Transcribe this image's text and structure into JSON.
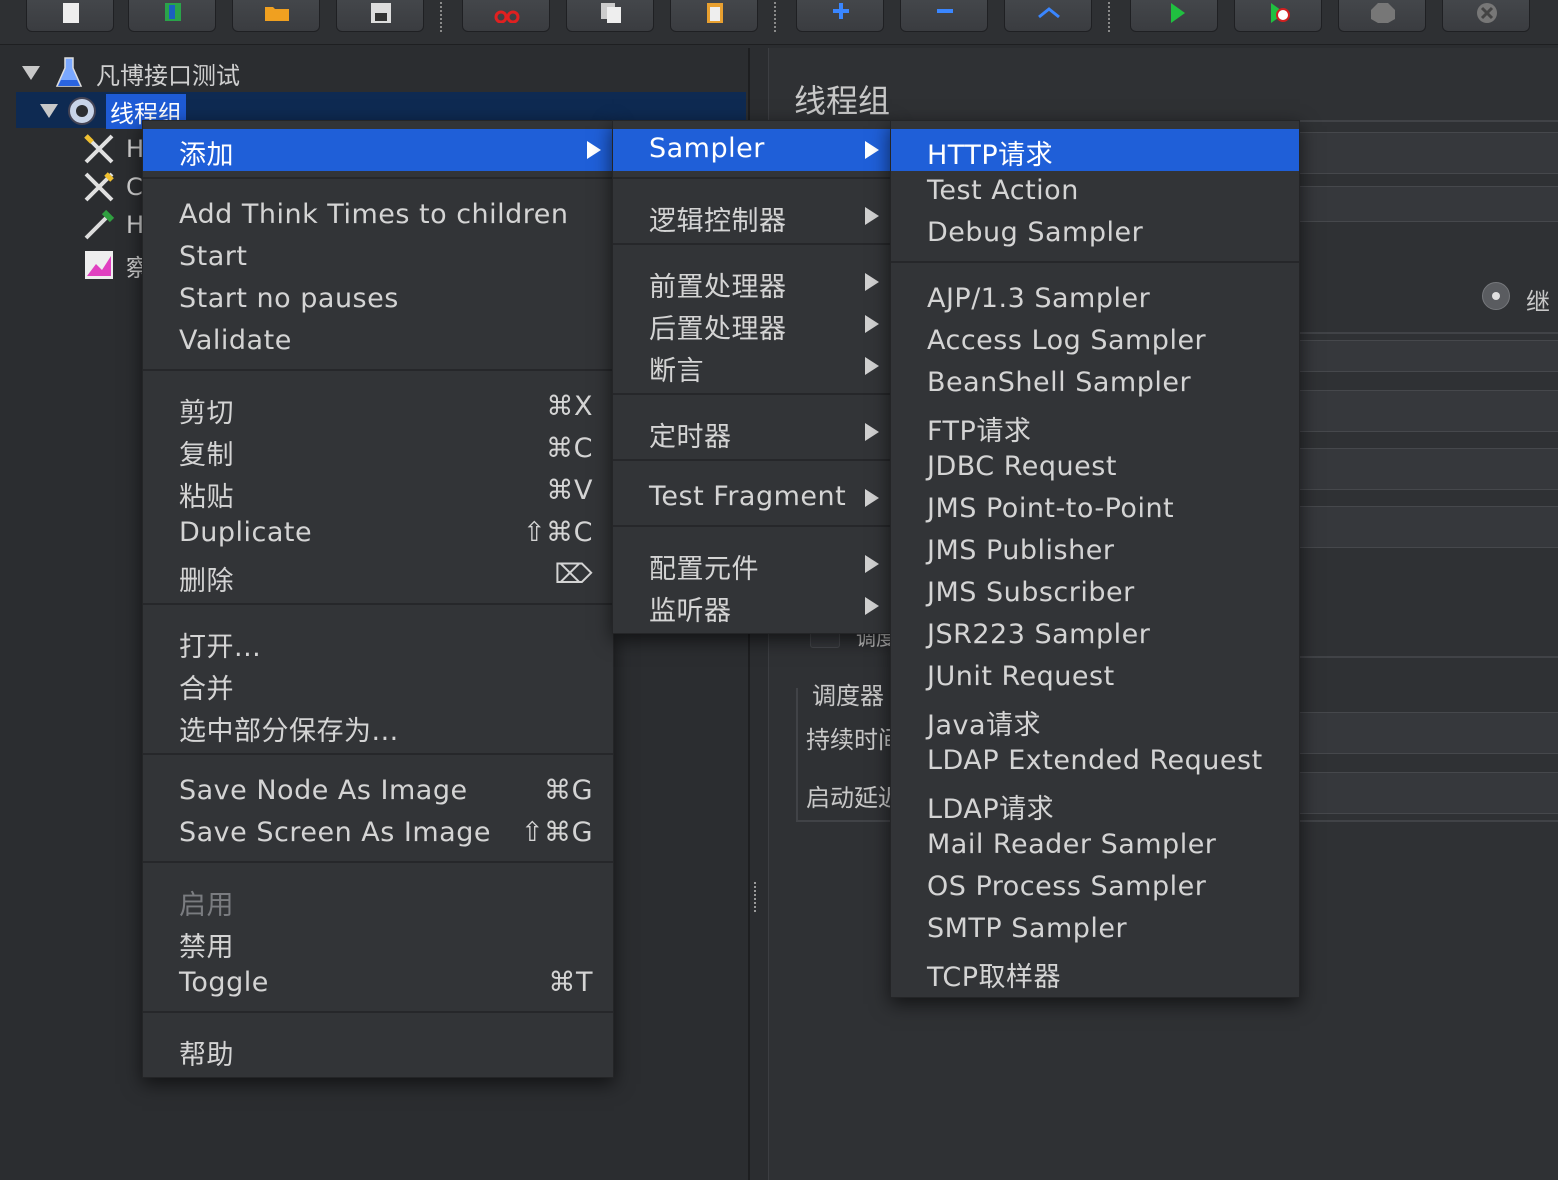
{
  "toolbar": {
    "buttons": [
      "new-icon",
      "templates-icon",
      "open-icon",
      "save-icon",
      "cut-icon",
      "copy-icon",
      "paste-icon",
      "expand-icon",
      "collapse-icon",
      "toggle-icon",
      "start-icon",
      "start-no-pauses-icon",
      "stop-icon",
      "shutdown-icon"
    ]
  },
  "tree": {
    "root": "凡博接口测试",
    "selected": "线程组",
    "children": [
      "H",
      "C",
      "H",
      "察"
    ]
  },
  "right_panel": {
    "title": "线程组",
    "radio_label": "继",
    "fragment_label": "调度",
    "scheduler_label": "调度器",
    "duration_label": "持续时间",
    "delay_label": "启动延迟"
  },
  "context_menu": {
    "add": "添加",
    "items_group1": [
      "Add Think Times to children",
      "Start",
      "Start no pauses",
      "Validate"
    ],
    "cut": {
      "label": "剪切",
      "shortcut": "⌘X"
    },
    "copy": {
      "label": "复制",
      "shortcut": "⌘C"
    },
    "paste": {
      "label": "粘贴",
      "shortcut": "⌘V"
    },
    "duplicate": {
      "label": "Duplicate",
      "shortcut": "⇧⌘C"
    },
    "delete": {
      "label": "删除",
      "shortcut": "⌦"
    },
    "open": "打开...",
    "merge": "合并",
    "save_selection": "选中部分保存为...",
    "save_node_image": {
      "label": "Save Node As Image",
      "shortcut": "⌘G"
    },
    "save_screen_image": {
      "label": "Save Screen As Image",
      "shortcut": "⇧⌘G"
    },
    "enable": "启用",
    "disable": "禁用",
    "toggle": {
      "label": "Toggle",
      "shortcut": "⌘T"
    },
    "help": "帮助"
  },
  "add_submenu": {
    "items": [
      "Sampler",
      "逻辑控制器",
      "前置处理器",
      "后置处理器",
      "断言",
      "定时器",
      "Test Fragment",
      "配置元件",
      "监听器"
    ]
  },
  "sampler_submenu": {
    "group1": [
      "HTTP请求",
      "Test Action",
      "Debug Sampler"
    ],
    "group2": [
      "AJP/1.3 Sampler",
      "Access Log Sampler",
      "BeanShell Sampler",
      "FTP请求",
      "JDBC Request",
      "JMS Point-to-Point",
      "JMS Publisher",
      "JMS Subscriber",
      "JSR223 Sampler",
      "JUnit Request",
      "Java请求",
      "LDAP Extended Request",
      "LDAP请求",
      "Mail Reader Sampler",
      "OS Process Sampler",
      "SMTP Sampler",
      "TCP取样器"
    ]
  },
  "colors": {
    "highlight": "#1f5fd8",
    "background": "#2b2d30",
    "menu": "#323437"
  }
}
